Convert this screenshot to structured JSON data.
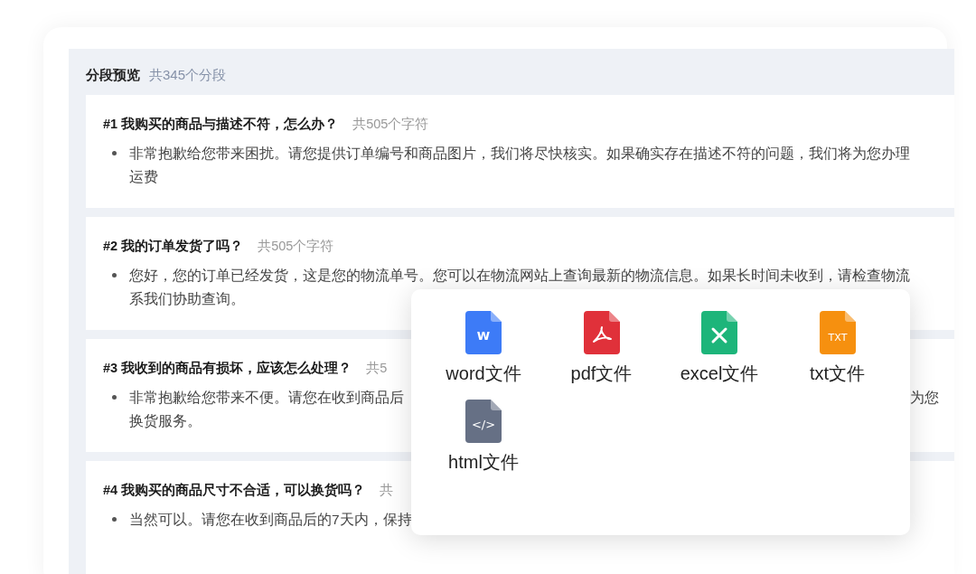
{
  "preview": {
    "title": "分段预览",
    "count": "共345个分段"
  },
  "segments": [
    {
      "title": "#1 我购买的商品与描述不符，怎么办？",
      "count": "共505个字符",
      "lines": [
        {
          "start": "非常抱歉给您带来困扰。请您提供订单编号和商品图片，我们将尽快核实。如果确实存在描述不符的问题，我们将为您办理"
        },
        {
          "start": "运费"
        }
      ]
    },
    {
      "title": "#2 我的订单发货了吗？",
      "count": "共505个字符",
      "lines": [
        {
          "start": "您好，您的订单已经发货，这是您的物流单号。您可以在物流网站上查询最新的物流信息。如果长时间未收到，请检查物流"
        },
        {
          "start": "系我们协助查询。"
        }
      ]
    },
    {
      "title": "#3 我收到的商品有损坏，应该怎么处理？",
      "count": "共5",
      "lines": [
        {
          "start": "非常抱歉给您带来不便。请您在收到商品后",
          "end": "为您"
        },
        {
          "start": "换货服务。"
        }
      ]
    },
    {
      "title": "#4 我购买的商品尺寸不合适，可以换货吗？",
      "count": "共",
      "lines": [
        {
          "start": "当然可以。请您在收到商品后的7天内，保持"
        }
      ]
    }
  ],
  "export_menu": [
    {
      "kind": "word",
      "label": "word文件",
      "glyph": "W"
    },
    {
      "kind": "pdf",
      "label": "pdf文件"
    },
    {
      "kind": "excel",
      "label": "excel文件"
    },
    {
      "kind": "txt",
      "label": "txt文件",
      "glyph": "TXT"
    },
    {
      "kind": "html",
      "label": "html文件",
      "glyph": "</>"
    }
  ]
}
